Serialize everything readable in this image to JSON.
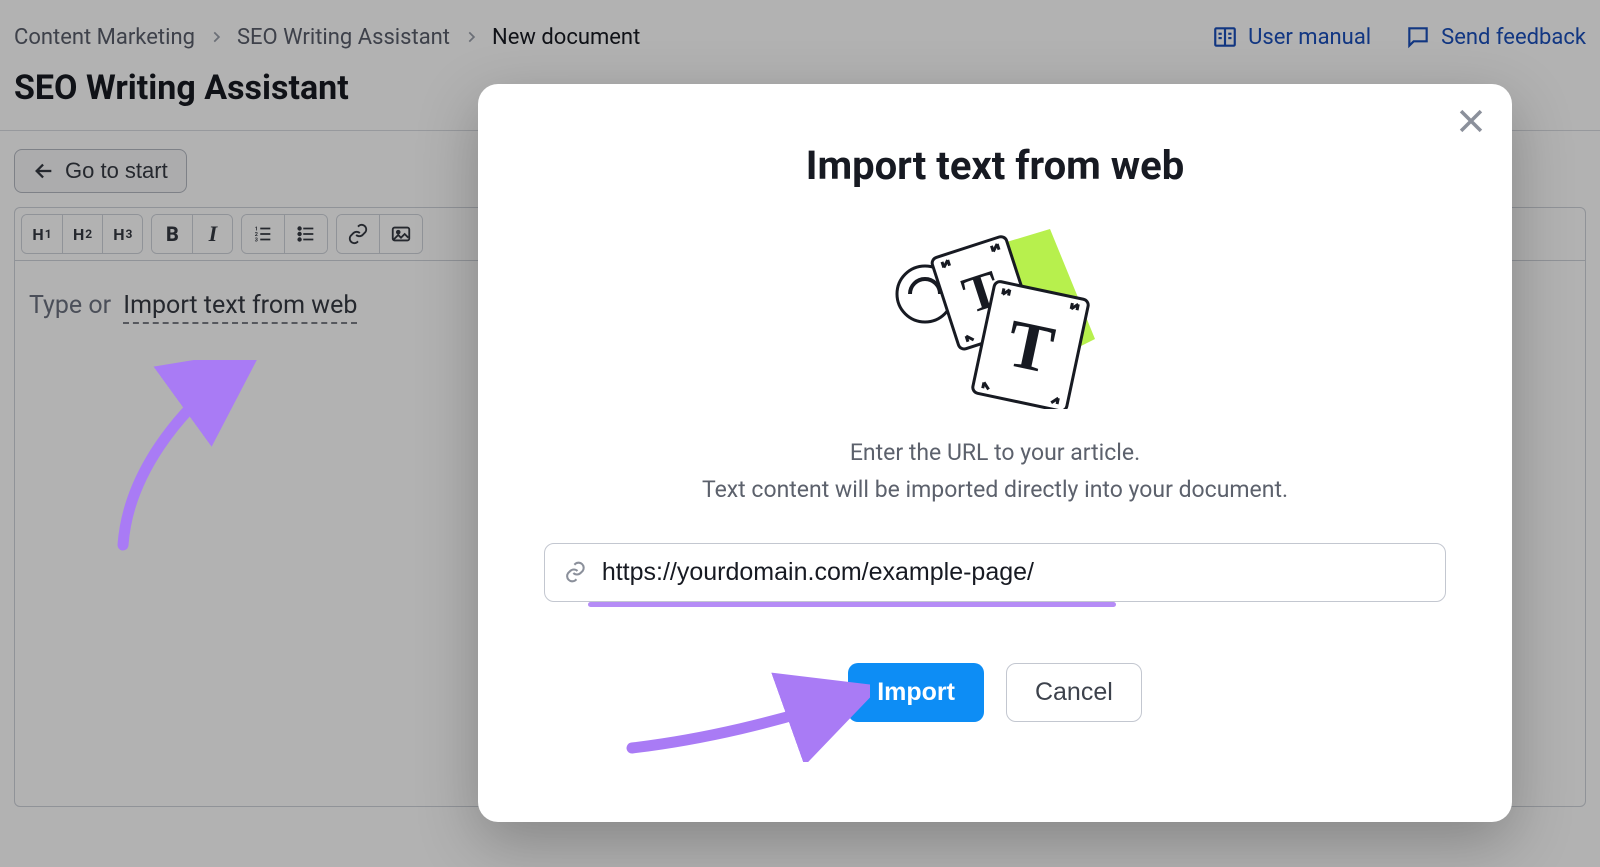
{
  "breadcrumb": {
    "items": [
      "Content Marketing",
      "SEO Writing Assistant",
      "New document"
    ]
  },
  "header_links": {
    "manual": "User manual",
    "feedback": "Send feedback"
  },
  "page_title": "SEO Writing Assistant",
  "go_to_start": "Go to start",
  "toolbar": {
    "h1": "H",
    "h1s": "1",
    "h2": "H",
    "h2s": "2",
    "h3": "H",
    "h3s": "3",
    "bold": "B",
    "italic": "I"
  },
  "editor": {
    "type_or": "Type or ",
    "import_link": "Import text from web"
  },
  "modal": {
    "title": "Import text from web",
    "desc_line1": "Enter the URL to your article.",
    "desc_line2": "Text content will be imported directly into your document.",
    "url_value": "https://yourdomain.com/example-page/",
    "import_btn": "Import",
    "cancel_btn": "Cancel"
  }
}
